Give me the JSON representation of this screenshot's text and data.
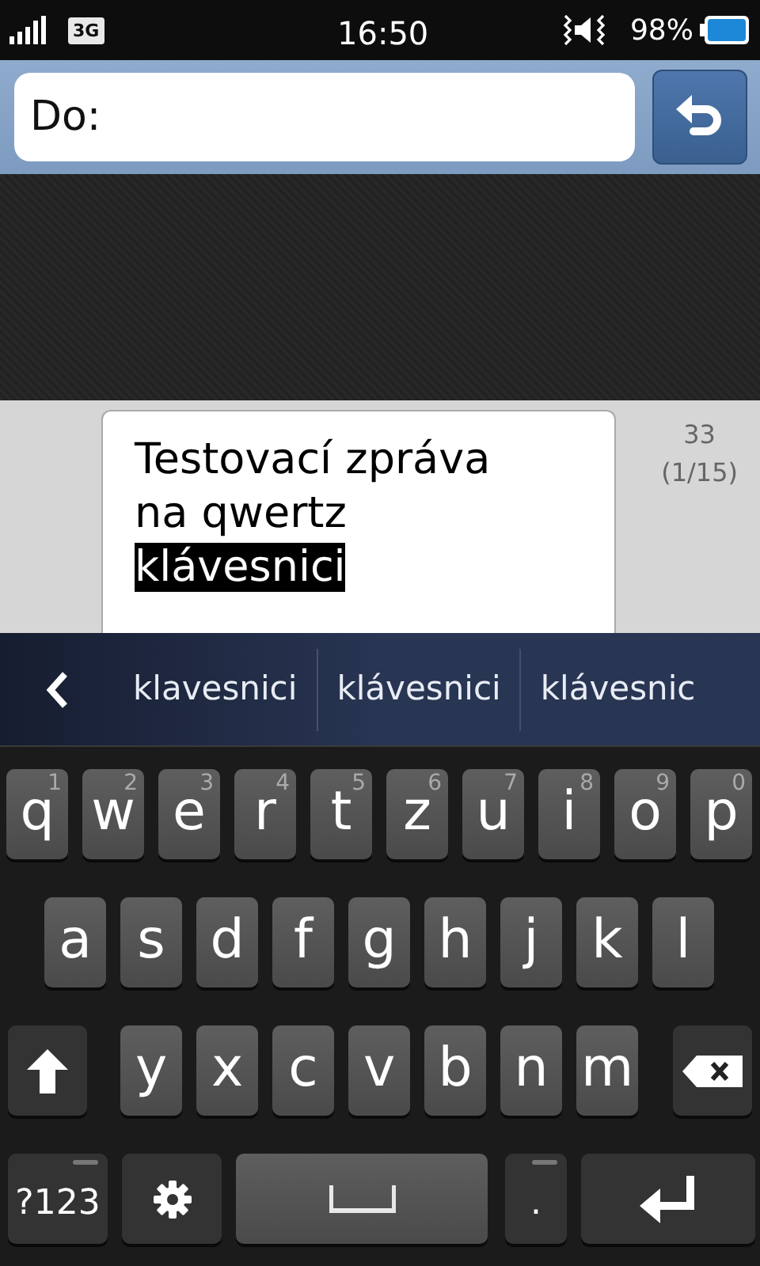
{
  "status_bar": {
    "network": "3G",
    "time": "16:50",
    "battery": "98%"
  },
  "recipient": {
    "placeholder": "Do:"
  },
  "message": {
    "text": "Testovací zpráva na qwertz",
    "selected_text": "klávesnici",
    "char_count": "33",
    "sms_count": "(1/15)"
  },
  "suggestions": [
    "klavesnici",
    "klávesnici",
    "klávesnic"
  ],
  "keyboard": [
    [
      {
        "kind": "letter",
        "label": "q",
        "hint": "1"
      },
      {
        "kind": "letter",
        "label": "w",
        "hint": "2"
      },
      {
        "kind": "letter",
        "label": "e",
        "hint": "3"
      },
      {
        "kind": "letter",
        "label": "r",
        "hint": "4"
      },
      {
        "kind": "letter",
        "label": "t",
        "hint": "5"
      },
      {
        "kind": "letter",
        "label": "z",
        "hint": "6"
      },
      {
        "kind": "letter",
        "label": "u",
        "hint": "7"
      },
      {
        "kind": "letter",
        "label": "i",
        "hint": "8"
      },
      {
        "kind": "letter",
        "label": "o",
        "hint": "9"
      },
      {
        "kind": "letter",
        "label": "p",
        "hint": "0"
      }
    ],
    [
      {
        "kind": "letter",
        "label": "a"
      },
      {
        "kind": "letter",
        "label": "s"
      },
      {
        "kind": "letter",
        "label": "d"
      },
      {
        "kind": "letter",
        "label": "f"
      },
      {
        "kind": "letter",
        "label": "g"
      },
      {
        "kind": "letter",
        "label": "h"
      },
      {
        "kind": "letter",
        "label": "j"
      },
      {
        "kind": "letter",
        "label": "k"
      },
      {
        "kind": "letter",
        "label": "l"
      }
    ],
    [
      {
        "kind": "shift"
      },
      {
        "kind": "letter",
        "label": "y"
      },
      {
        "kind": "letter",
        "label": "x"
      },
      {
        "kind": "letter",
        "label": "c"
      },
      {
        "kind": "letter",
        "label": "v"
      },
      {
        "kind": "letter",
        "label": "b"
      },
      {
        "kind": "letter",
        "label": "n"
      },
      {
        "kind": "letter",
        "label": "m"
      },
      {
        "kind": "delete"
      }
    ],
    [
      {
        "kind": "symbols",
        "label": "?123"
      },
      {
        "kind": "settings"
      },
      {
        "kind": "space"
      },
      {
        "kind": "period",
        "label": "."
      },
      {
        "kind": "enter"
      }
    ]
  ]
}
